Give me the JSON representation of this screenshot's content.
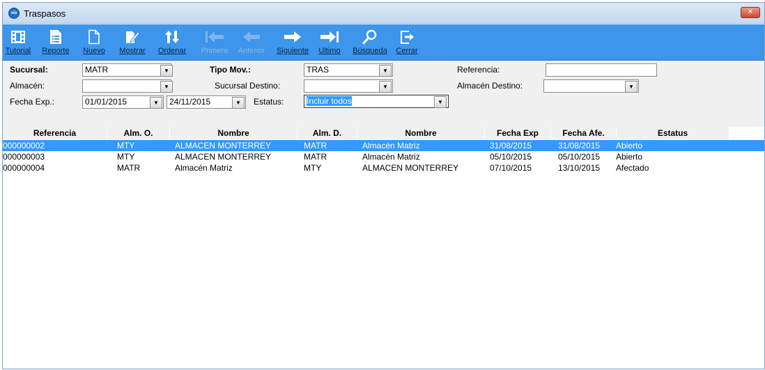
{
  "window": {
    "title": "Traspasos",
    "icon_text": "vía",
    "close_label": "✕"
  },
  "toolbar": {
    "buttons": [
      {
        "label": "Tutorial",
        "icon": "film-icon",
        "enabled": true
      },
      {
        "label": "Reporte",
        "icon": "report-icon",
        "enabled": true
      },
      {
        "label": "Nuevo",
        "icon": "new-document-icon",
        "enabled": true
      },
      {
        "label": "Mostrar",
        "icon": "edit-icon",
        "enabled": true
      },
      {
        "label": "Ordenar",
        "icon": "sort-icon",
        "enabled": true
      },
      {
        "label": "Primero",
        "icon": "first-icon",
        "enabled": false
      },
      {
        "label": "Anterior",
        "icon": "previous-icon",
        "enabled": false
      },
      {
        "label": "Siguiente",
        "icon": "next-icon",
        "enabled": true
      },
      {
        "label": "Ultimo",
        "icon": "last-icon",
        "enabled": true
      },
      {
        "label": "Búsqueda",
        "icon": "search-icon",
        "enabled": true
      },
      {
        "label": "Cerrar",
        "icon": "exit-icon",
        "enabled": true
      }
    ]
  },
  "filters": {
    "sucursal_label": "Sucursal:",
    "sucursal_value": "MATR",
    "tipo_mov_label": "Tipo Mov.:",
    "tipo_mov_value": "TRAS",
    "referencia_label": "Referencia:",
    "referencia_value": "",
    "almacen_label": "Almacén:",
    "almacen_value": "",
    "sucursal_destino_label": "Sucursal Destino:",
    "sucursal_destino_value": "",
    "almacen_destino_label": "Almacén Destino:",
    "almacen_destino_value": "",
    "fecha_exp_label": "Fecha Exp.:",
    "fecha_desde": "01/01/2015",
    "fecha_hasta": "24/11/2015",
    "estatus_label": "Estatus:",
    "estatus_value": "Incluir todos"
  },
  "table": {
    "columns": [
      "Referencia",
      "Alm. O.",
      "Nombre",
      "Alm. D.",
      "Nombre",
      "Fecha Exp",
      "Fecha Afe.",
      "Estatus"
    ],
    "rows": [
      [
        "000000002",
        "MTY",
        "ALMACEN MONTERREY",
        "MATR",
        "Almacén Matriz",
        "31/08/2015",
        "31/08/2015",
        "Abierto"
      ],
      [
        "000000003",
        "MTY",
        "ALMACEN MONTERREY",
        "MATR",
        "Almacén Matriz",
        "05/10/2015",
        "05/10/2015",
        "Abierto"
      ],
      [
        "000000004",
        "MATR",
        "Almacén Matriz",
        "MTY",
        "ALMACEN MONTERREY",
        "07/10/2015",
        "13/10/2015",
        "Afectado"
      ]
    ],
    "selected_row": 0
  },
  "colors": {
    "toolbar": "#3d95ec",
    "selection": "#3399ff",
    "title_bar": "#c5d9ef"
  }
}
